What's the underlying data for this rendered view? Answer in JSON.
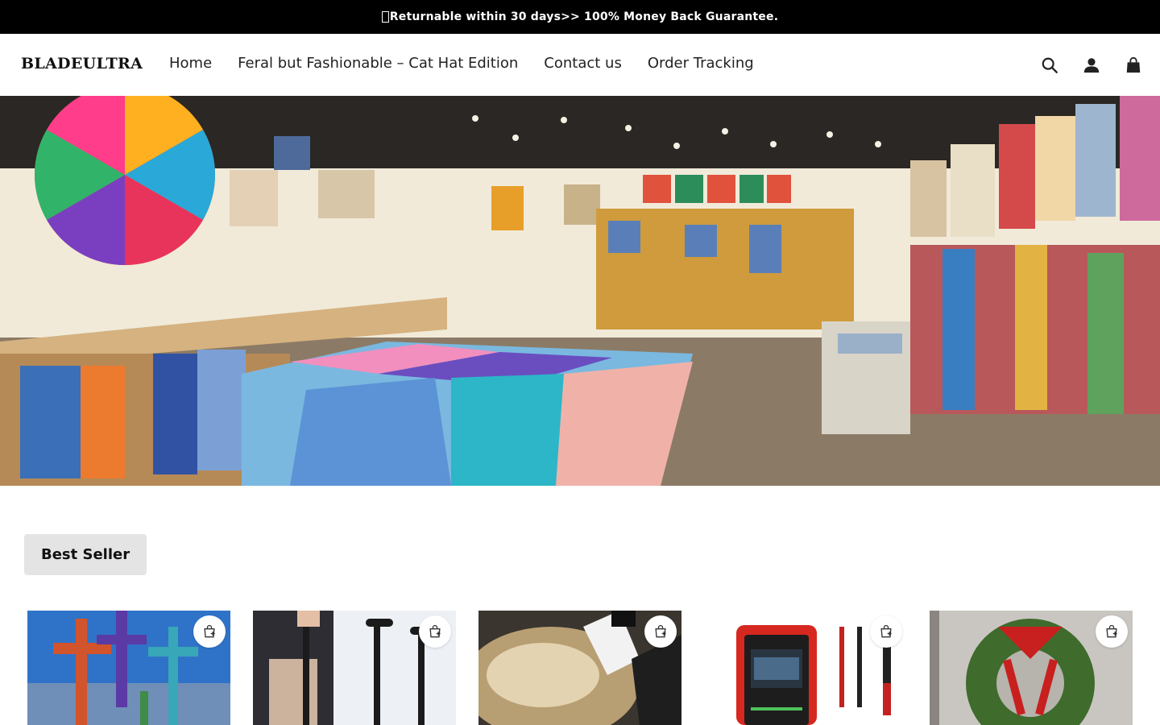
{
  "announcement": {
    "text": "Returnable within 30 days>> 100% Money Back Guarantee."
  },
  "header": {
    "logo": "BLADEULTRA",
    "nav": [
      {
        "label": "Home"
      },
      {
        "label": "Feral but Fashionable – Cat Hat Edition"
      },
      {
        "label": "Contact us"
      },
      {
        "label": "Order Tracking"
      }
    ],
    "icons": [
      "search-icon",
      "account-icon",
      "shopping-bag-icon"
    ]
  },
  "hero": {
    "image": "quilt-shop-interior"
  },
  "best_seller": {
    "heading": "Best Seller",
    "products": [
      {
        "image": "stained-glass-crosses",
        "cart_icon": "add-to-cart-icon"
      },
      {
        "image": "folding-walking-cane",
        "cart_icon": "add-to-cart-icon"
      },
      {
        "image": "spray-bottle-cleaner",
        "cart_icon": "add-to-cart-icon"
      },
      {
        "image": "digital-multimeter",
        "cart_icon": "add-to-cart-icon"
      },
      {
        "image": "pine-wreath-red-bow",
        "cart_icon": "add-to-cart-icon"
      }
    ]
  },
  "colors": {
    "announcement_bg": "#000000",
    "badge_bg": "#e4e4e4",
    "text": "#222222"
  }
}
